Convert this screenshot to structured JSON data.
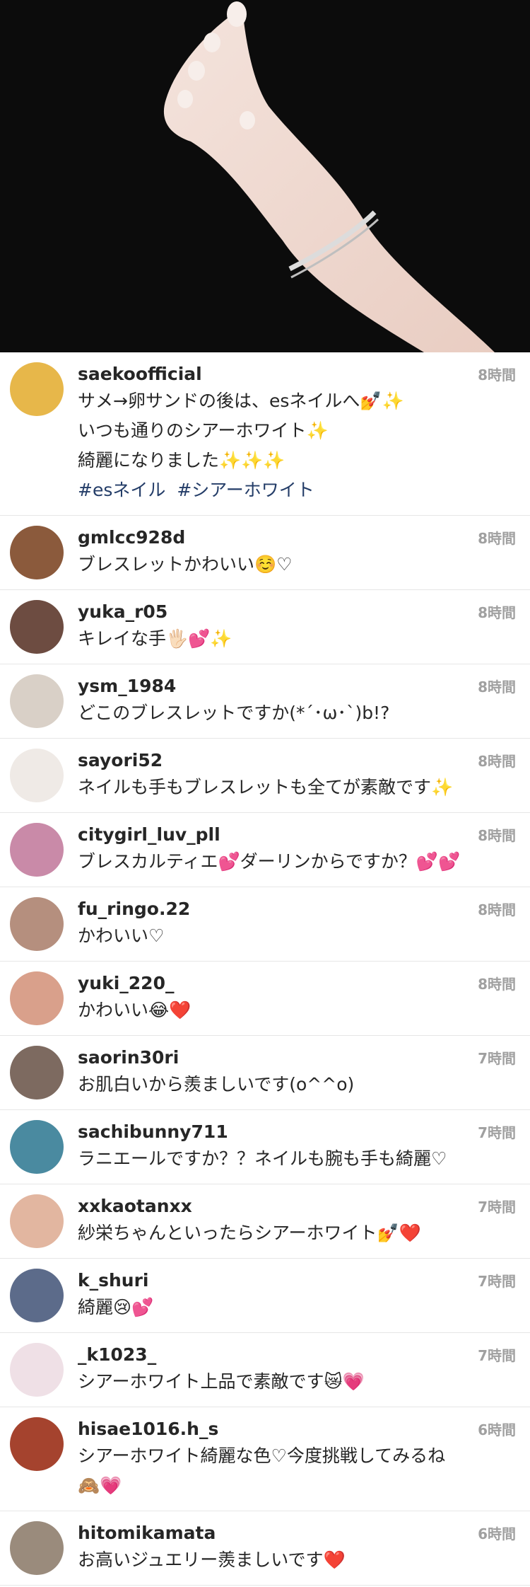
{
  "header_photo": {
    "alt": "hand-bracelet-photo"
  },
  "comments": [
    {
      "user": "saekoofficial",
      "time": "8時間",
      "lines": [
        "サメ→卵サンドの後は、esネイルへ💅✨",
        "いつも通りのシアーホワイト✨",
        "綺麗になりました✨✨✨"
      ],
      "tags": [
        "#esネイル",
        "#シアーホワイト"
      ],
      "avatar_color": "#e7b74a"
    },
    {
      "user": "gmlcc928d",
      "time": "8時間",
      "lines": [
        "ブレスレットかわいい☺️♡"
      ],
      "avatar_color": "#8b5a3c"
    },
    {
      "user": "yuka_r05",
      "time": "8時間",
      "lines": [
        "キレイな手🖐🏻💕✨"
      ],
      "avatar_color": "#6d4c41"
    },
    {
      "user": "ysm_1984",
      "time": "8時間",
      "lines": [
        "どこのブレスレットですか(*´･ω･`)b!?"
      ],
      "avatar_color": "#d9d0c7"
    },
    {
      "user": "sayori52",
      "time": "8時間",
      "lines": [
        "ネイルも手もブレスレットも全てが素敵です✨"
      ],
      "avatar_color": "#efeae6"
    },
    {
      "user": "citygirl_luv_pll",
      "time": "8時間",
      "lines": [
        "ブレスカルティエ💕ダーリンからですか？💕💕"
      ],
      "avatar_color": "#c98aa8"
    },
    {
      "user": "fu_ringo.22",
      "time": "8時間",
      "lines": [
        "かわいい♡"
      ],
      "avatar_color": "#b58f7e"
    },
    {
      "user": "yuki_220_",
      "time": "8時間",
      "lines": [
        "かわいい😂❤️"
      ],
      "avatar_color": "#d9a08b"
    },
    {
      "user": "saorin30ri",
      "time": "7時間",
      "lines": [
        "お肌白いから羨ましいです(o^^o)"
      ],
      "avatar_color": "#7d6a60"
    },
    {
      "user": "sachibunny711",
      "time": "7時間",
      "lines": [
        "ラニエールですか？？ネイルも腕も手も綺麗♡"
      ],
      "avatar_color": "#4a8aa0"
    },
    {
      "user": "xxkaotanxx",
      "time": "7時間",
      "lines": [
        "紗栄ちゃんといったらシアーホワイト💅❤️"
      ],
      "avatar_color": "#e2b6a0"
    },
    {
      "user": "k_shuri",
      "time": "7時間",
      "lines": [
        "綺麗😢💕"
      ],
      "avatar_color": "#5c6b8a"
    },
    {
      "user": "_k1023_",
      "time": "7時間",
      "lines": [
        "シアーホワイト上品で素敵です😿💗"
      ],
      "avatar_color": "#efe0e6"
    },
    {
      "user": "hisae1016.h_s",
      "time": "6時間",
      "lines": [
        "シアーホワイト綺麗な色♡今度挑戦してみるね",
        "🙈💗"
      ],
      "avatar_color": "#a5432e"
    },
    {
      "user": "hitomikamata",
      "time": "6時間",
      "lines": [
        "お高いジュエリー羨ましいです❤️"
      ],
      "avatar_color": "#9a8b7c"
    }
  ]
}
